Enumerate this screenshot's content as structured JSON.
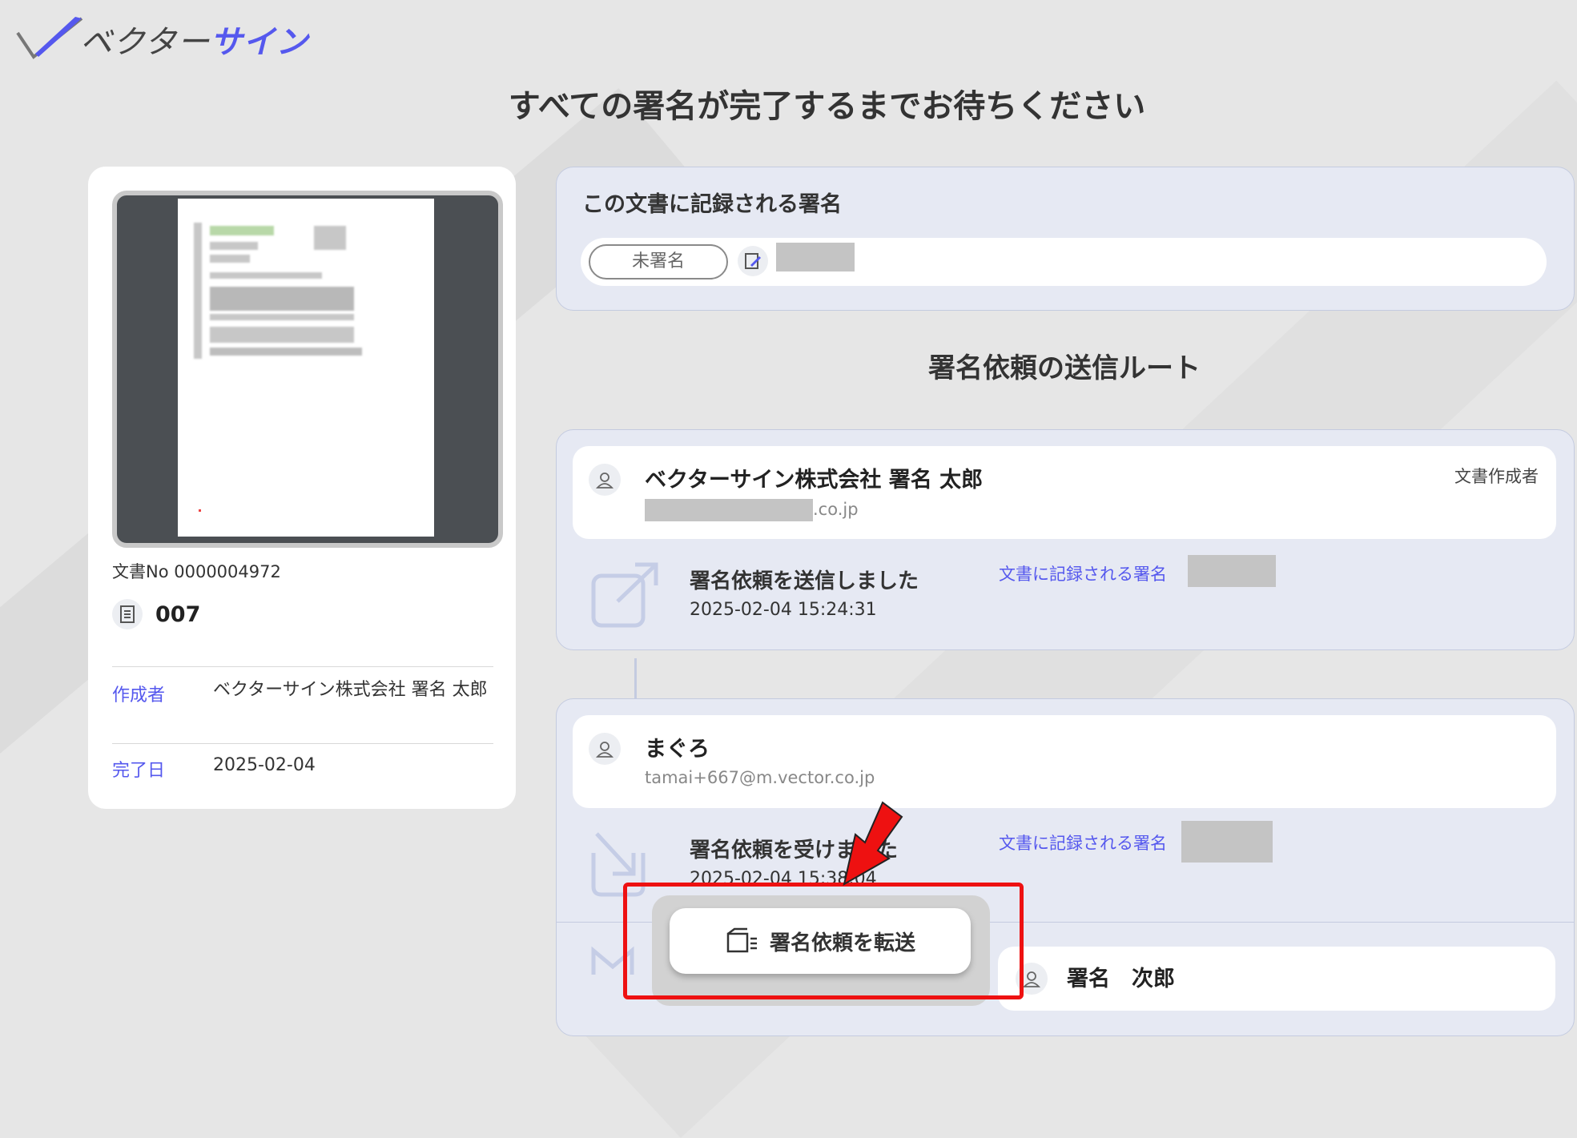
{
  "logo": {
    "text_dark": "ベクター",
    "text_accent": "サイン"
  },
  "page_title": "すべての署名が完了するまでお待ちください",
  "document": {
    "doc_no": "文書No 0000004972",
    "name": "007",
    "creator_label": "作成者",
    "creator_value": "ベクターサイン株式会社 署名 太郎",
    "completed_label": "完了日",
    "completed_value": "2025-02-04"
  },
  "signature_panel": {
    "title": "この文書に記録される署名",
    "status": "未署名"
  },
  "route": {
    "title": "署名依頼の送信ルート",
    "steps": [
      {
        "name": "ベクターサイン株式会社 署名 太郎",
        "email_suffix": ".co.jp",
        "role": "文書作成者",
        "action": "署名依頼を送信しました",
        "time": "2025-02-04 15:24:31",
        "link": "文書に記録される署名"
      },
      {
        "name": "まぐろ",
        "email": "tamai+667@m.vector.co.jp",
        "action": "署名依頼を受けました",
        "time": "2025-02-04 15:38:04",
        "link": "文書に記録される署名"
      },
      {
        "name": "署名　次郎"
      }
    ]
  },
  "forward_button": {
    "label": "署名依頼を転送"
  },
  "colors": {
    "accent": "#5558ee",
    "highlight": "#ee1111"
  }
}
